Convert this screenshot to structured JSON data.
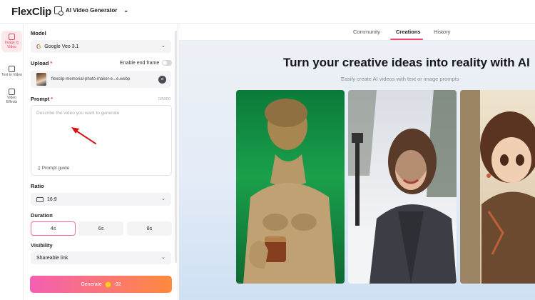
{
  "topbar": {
    "logo_text": "FlexClip",
    "tool_label": "AI Video Generator"
  },
  "rail": {
    "items": [
      {
        "label": "Image to Video",
        "icon": "image-video-icon"
      },
      {
        "label": "Text to Video",
        "icon": "text-video-icon"
      },
      {
        "label": "Video Effects",
        "icon": "video-effects-icon"
      }
    ]
  },
  "panel": {
    "model_label": "Model",
    "model_value": "Google Veo 3.1",
    "upload_label": "Upload",
    "end_frame_label": "Enable end frame",
    "upload_filename": "flexclip-memorial-photo-maker-e...e.webp",
    "prompt_label": "Prompt",
    "prompt_counter": "0/5000",
    "prompt_placeholder": "Describe the video you want to generate",
    "prompt_guide": "Prompt guide",
    "ratio_label": "Ratio",
    "ratio_value": "16:9",
    "duration_label": "Duration",
    "durations": [
      "4s",
      "6s",
      "8s"
    ],
    "visibility_label": "Visibility",
    "visibility_value": "Shareable link",
    "generate_label": "Generate",
    "generate_cost": "-92"
  },
  "main": {
    "tabs": [
      "Community",
      "Creations",
      "History"
    ],
    "active_tab": "Creations",
    "headline": "Turn your creative ideas into reality with AI",
    "subheadline": "Easily create AI videos with text or image prompts"
  },
  "colors": {
    "accent": "#ef476f",
    "generate_start": "#f45fb3",
    "generate_end": "#ff8a3d"
  }
}
